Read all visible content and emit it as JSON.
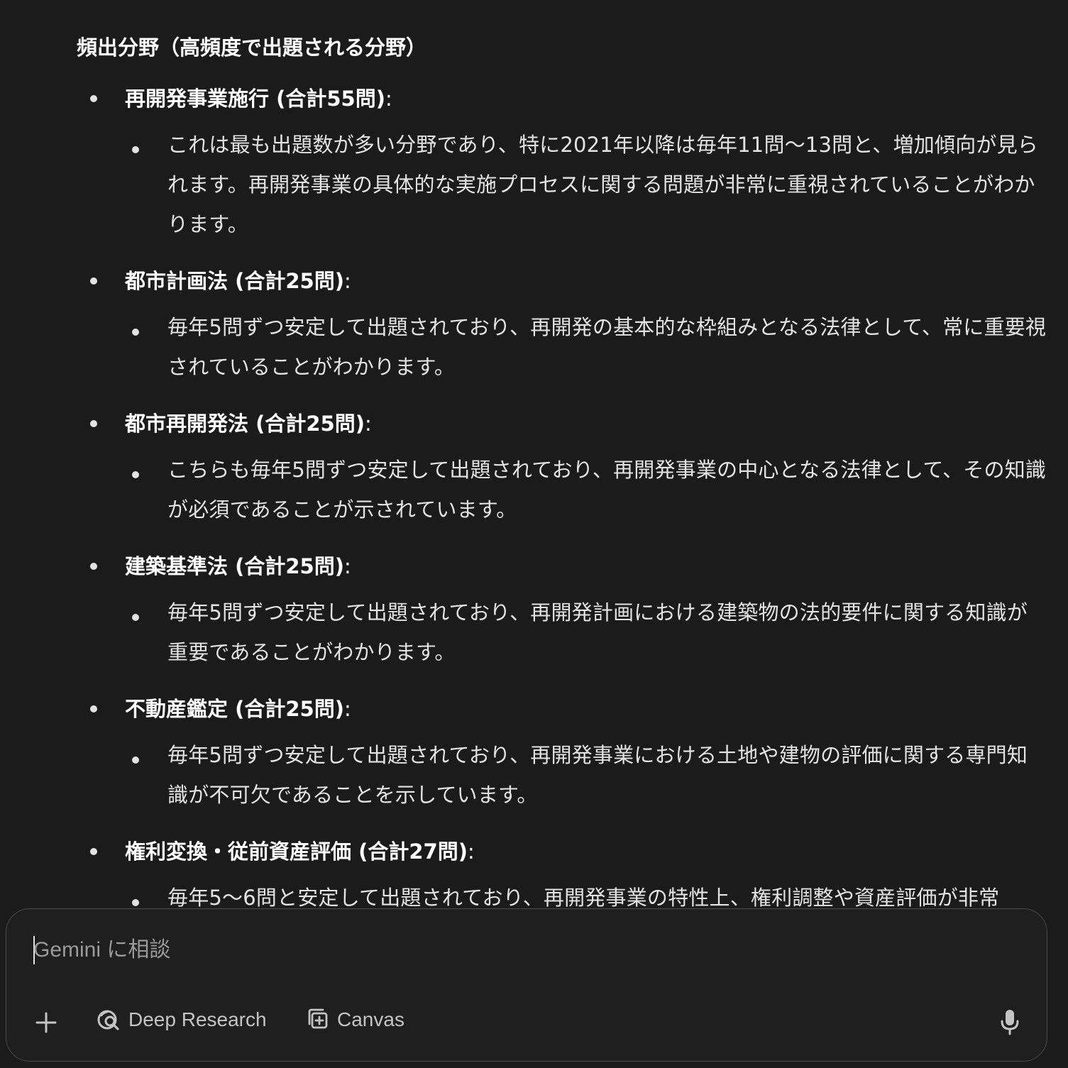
{
  "response": {
    "heading": "頻出分野（高頻度で出題される分野）",
    "items": [
      {
        "title_bold": "再開発事業施行 (合計55問)",
        "title_suffix": ":",
        "description": "これは最も出題数が多い分野であり、特に2021年以降は毎年11問〜13問と、増加傾向が見られます。再開発事業の具体的な実施プロセスに関する問題が非常に重視されていることがわかります。"
      },
      {
        "title_bold": "都市計画法 (合計25問)",
        "title_suffix": ":",
        "description": "毎年5問ずつ安定して出題されており、再開発の基本的な枠組みとなる法律として、常に重要視されていることがわかります。"
      },
      {
        "title_bold": "都市再開発法 (合計25問)",
        "title_suffix": ":",
        "description": "こちらも毎年5問ずつ安定して出題されており、再開発事業の中心となる法律として、その知識が必須であることが示されています。"
      },
      {
        "title_bold": "建築基準法 (合計25問)",
        "title_suffix": ":",
        "description": "毎年5問ずつ安定して出題されており、再開発計画における建築物の法的要件に関する知識が重要であることがわかります。"
      },
      {
        "title_bold": "不動産鑑定 (合計25問)",
        "title_suffix": ":",
        "description": "毎年5問ずつ安定して出題されており、再開発事業における土地や建物の評価に関する専門知識が不可欠であることを示しています。"
      },
      {
        "title_bold": "権利変換・従前資産評価 (合計27問)",
        "title_suffix": ":",
        "description": "毎年5〜6問と安定して出題されており、再開発事業の特性上、権利調整や資産評価が非常"
      }
    ]
  },
  "input": {
    "placeholder": "Gemini に相談",
    "value": ""
  },
  "toolbar": {
    "add_icon": "plus-icon",
    "deep_research_icon": "deep-research-icon",
    "deep_research_label": "Deep Research",
    "canvas_icon": "canvas-icon",
    "canvas_label": "Canvas",
    "mic_icon": "microphone-icon"
  },
  "colors": {
    "background": "#1b1b1b",
    "text": "#e3e3e3",
    "input_border": "#4a4a4a",
    "toolbar_text": "#c4c4c4"
  }
}
